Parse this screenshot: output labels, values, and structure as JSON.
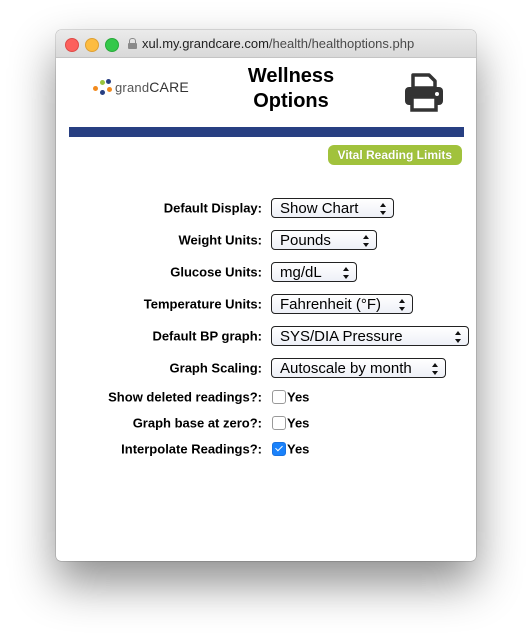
{
  "browser": {
    "url_host": "xul.my.grandcare.com",
    "url_path": "/health/healthoptions.php"
  },
  "header": {
    "logo_grand": "grand",
    "logo_care": "CARE",
    "title_line1": "Wellness",
    "title_line2": "Options",
    "print_icon": "printer-icon"
  },
  "colors": {
    "header_bar": "#283f82",
    "vital_button": "#a1c23c",
    "checkbox_checked": "#1a82fb"
  },
  "vital_button_label": "Vital Reading Limits",
  "settings": [
    {
      "label": "Default Display:",
      "value": "Show Chart"
    },
    {
      "label": "Weight Units:",
      "value": "Pounds"
    },
    {
      "label": "Glucose Units:",
      "value": "mg/dL"
    },
    {
      "label": "Temperature Units:",
      "value": "Fahrenheit (°F)"
    },
    {
      "label": "Default BP graph:",
      "value": "SYS/DIA Pressure"
    },
    {
      "label": "Graph Scaling:",
      "value": "Autoscale by month"
    }
  ],
  "toggles": [
    {
      "label": "Show deleted readings?:",
      "option": "Yes",
      "checked": false
    },
    {
      "label": "Graph base at zero?:",
      "option": "Yes",
      "checked": false
    },
    {
      "label": "Interpolate Readings?:",
      "option": "Yes",
      "checked": true
    }
  ]
}
